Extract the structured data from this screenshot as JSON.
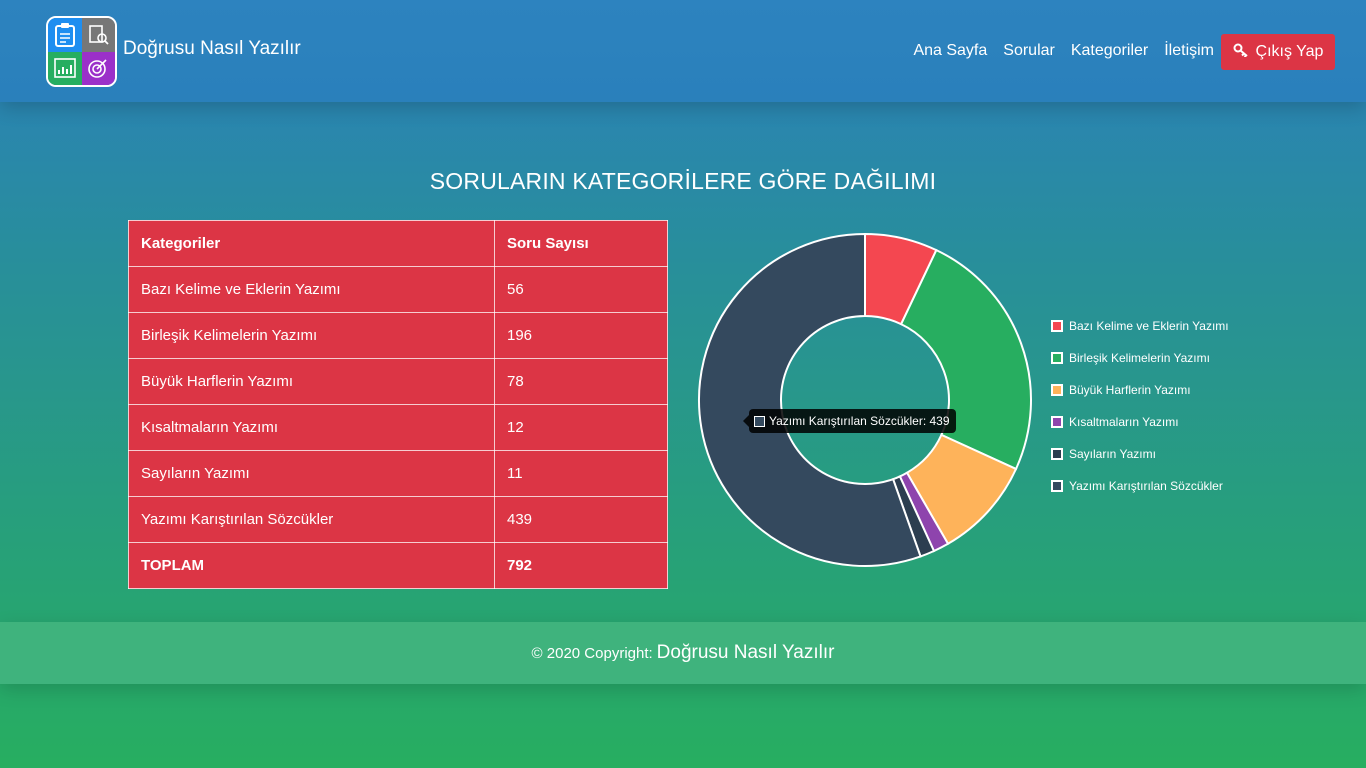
{
  "navbar": {
    "brand": "Doğrusu Nasıl Yazılır",
    "links": [
      "Ana Sayfa",
      "Sorular",
      "Kategoriler",
      "İletişim"
    ],
    "logout_label": "Çıkış Yap"
  },
  "main": {
    "title": "SORULARIN KATEGORİLERE GÖRE DAĞILIMI",
    "table": {
      "headers": [
        "Kategoriler",
        "Soru Sayısı"
      ],
      "rows": [
        [
          "Bazı Kelime ve Eklerin Yazımı",
          "56"
        ],
        [
          "Birleşik Kelimelerin Yazımı",
          "196"
        ],
        [
          "Büyük Harflerin Yazımı",
          "78"
        ],
        [
          "Kısaltmaların Yazımı",
          "12"
        ],
        [
          "Sayıların Yazımı",
          "11"
        ],
        [
          "Yazımı Karıştırılan Sözcükler",
          "439"
        ]
      ],
      "total": [
        "TOPLAM",
        "792"
      ]
    },
    "tooltip": "Yazımı Karıştırılan Sözcükler: 439"
  },
  "chart_data": {
    "type": "pie",
    "categories": [
      "Bazı Kelime ve Eklerin Yazımı",
      "Birleşik Kelimelerin Yazımı",
      "Büyük Harflerin Yazımı",
      "Kısaltmaların Yazımı",
      "Sayıların Yazımı",
      "Yazımı Karıştırılan Sözcükler"
    ],
    "values": [
      56,
      196,
      78,
      12,
      11,
      439
    ],
    "colors": [
      "#f44750",
      "#27ae60",
      "#feb35a",
      "#8e44ad",
      "#2c3e50",
      "#34495e"
    ],
    "legend_position": "right"
  },
  "footer": {
    "copyright": "© 2020 Copyright:",
    "brand": "Doğrusu Nasıl Yazılır"
  }
}
